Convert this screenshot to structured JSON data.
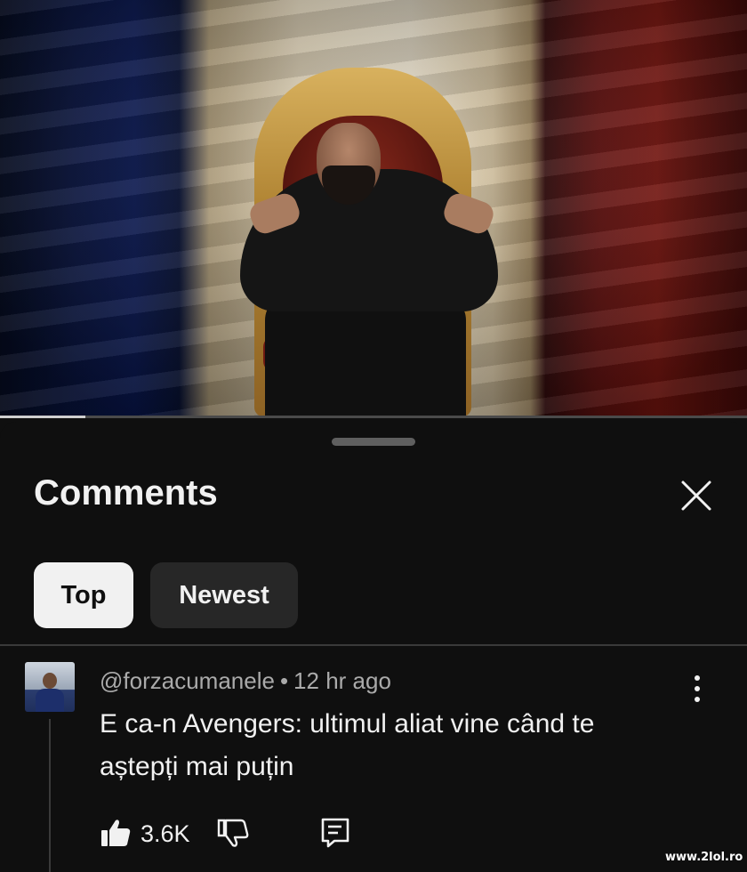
{
  "video": {
    "progress": 0.114
  },
  "sheet": {
    "title": "Comments",
    "close_icon": "close-icon",
    "filters": [
      {
        "label": "Top",
        "selected": true
      },
      {
        "label": "Newest",
        "selected": false
      }
    ]
  },
  "comment": {
    "author": "@forzacumanele",
    "separator": "•",
    "time": "12 hr ago",
    "text": "E ca-n Avengers: ultimul aliat vine când te aștepți mai puțin",
    "likes": "3.6K",
    "icons": {
      "menu": "more-vert-icon",
      "like": "thumbs-up-icon",
      "dislike": "thumbs-down-icon",
      "reply": "reply-icon"
    }
  },
  "watermark": "www.2lol.ro",
  "colors": {
    "background": "#0f0f0f",
    "chip_selected": "#f1f1f1",
    "chip_unselected": "#272727",
    "secondary_text": "#aaaaaa"
  }
}
